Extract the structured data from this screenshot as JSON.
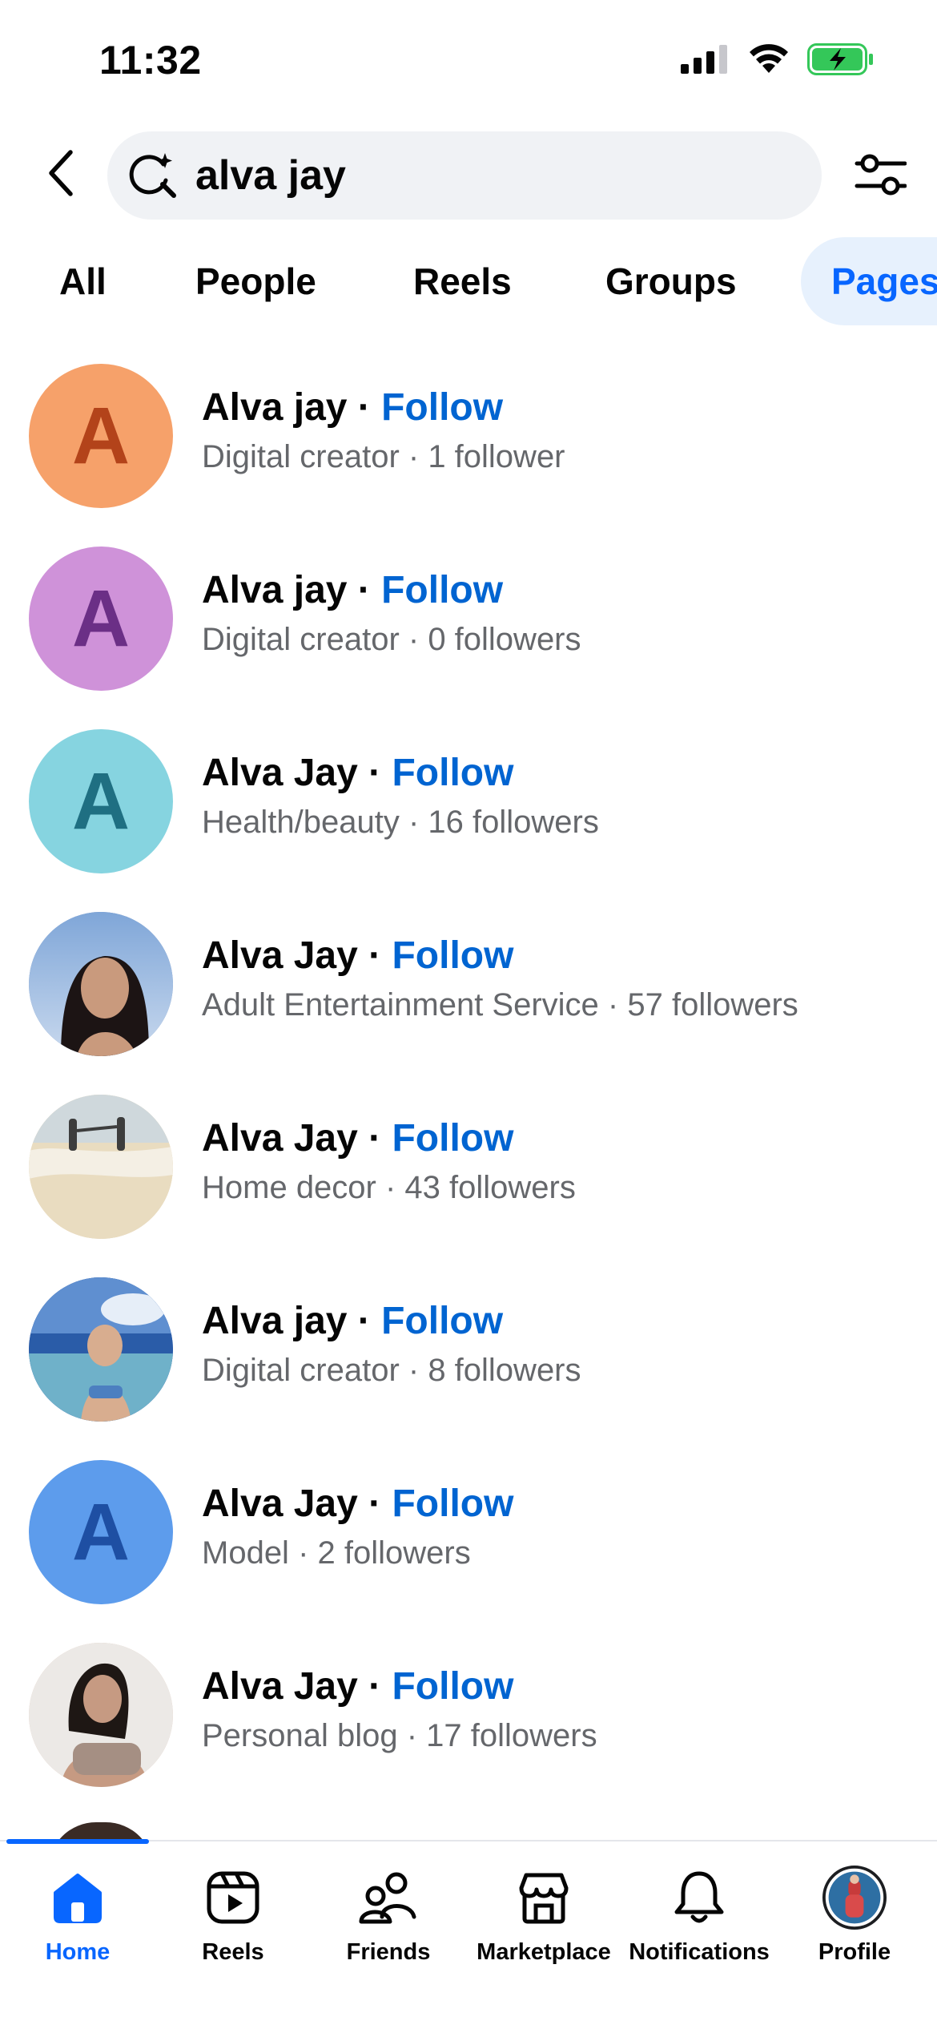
{
  "status_bar": {
    "time": "11:32"
  },
  "search": {
    "query": "alva jay"
  },
  "tabs": [
    {
      "label": "All"
    },
    {
      "label": "People"
    },
    {
      "label": "Reels"
    },
    {
      "label": "Groups"
    },
    {
      "label": "Pages"
    }
  ],
  "results": [
    {
      "name": "Alva jay",
      "separator": " · ",
      "follow": "Follow",
      "category": "Digital creator",
      "followers": "1 follower",
      "avatar_letter": "A",
      "avatar_bg": "#f6a16a",
      "avatar_fg": "#b3431a"
    },
    {
      "name": "Alva jay",
      "separator": " · ",
      "follow": "Follow",
      "category": "Digital creator",
      "followers": "0 followers",
      "avatar_letter": "A",
      "avatar_bg": "#cf92d9",
      "avatar_fg": "#6b2f86"
    },
    {
      "name": "Alva Jay",
      "separator": " · ",
      "follow": "Follow",
      "category": "Health/beauty",
      "followers": "16 followers",
      "avatar_letter": "A",
      "avatar_bg": "#86d4e0",
      "avatar_fg": "#1f6f82"
    },
    {
      "name": "Alva Jay",
      "separator": " · ",
      "follow": "Follow",
      "category": "Adult Entertainment Service",
      "followers": "57 followers",
      "avatar_letter": "",
      "avatar_bg": "#5c7fb8",
      "avatar_fg": "#ffffff"
    },
    {
      "name": "Alva Jay",
      "separator": " · ",
      "follow": "Follow",
      "category": "Home decor",
      "followers": "43 followers",
      "avatar_letter": "",
      "avatar_bg": "#dccba8",
      "avatar_fg": "#ffffff"
    },
    {
      "name": "Alva jay",
      "separator": " · ",
      "follow": "Follow",
      "category": "Digital creator",
      "followers": "8 followers",
      "avatar_letter": "",
      "avatar_bg": "#2f5fae",
      "avatar_fg": "#ffffff"
    },
    {
      "name": "Alva Jay",
      "separator": " · ",
      "follow": "Follow",
      "category": "Model",
      "followers": "2 followers",
      "avatar_letter": "A",
      "avatar_bg": "#5d9cec",
      "avatar_fg": "#1e4fa3"
    },
    {
      "name": "Alva Jay",
      "separator": " · ",
      "follow": "Follow",
      "category": "Personal blog",
      "followers": "17 followers",
      "avatar_letter": "",
      "avatar_bg": "#d9b9a5",
      "avatar_fg": "#ffffff"
    }
  ],
  "nav": [
    {
      "label": "Home",
      "icon": "home-icon",
      "active": true
    },
    {
      "label": "Reels",
      "icon": "reels-icon"
    },
    {
      "label": "Friends",
      "icon": "friends-icon"
    },
    {
      "label": "Marketplace",
      "icon": "marketplace-icon"
    },
    {
      "label": "Notifications",
      "icon": "bell-icon"
    },
    {
      "label": "Profile",
      "icon": "profile-avatar"
    }
  ],
  "colors": {
    "brand_blue": "#0866ff",
    "follow_blue": "#0064d1",
    "secondary_text": "#65676b",
    "search_bg": "#f0f2f5",
    "active_tab_bg": "#e7f1fd",
    "battery_green": "#34c759"
  }
}
